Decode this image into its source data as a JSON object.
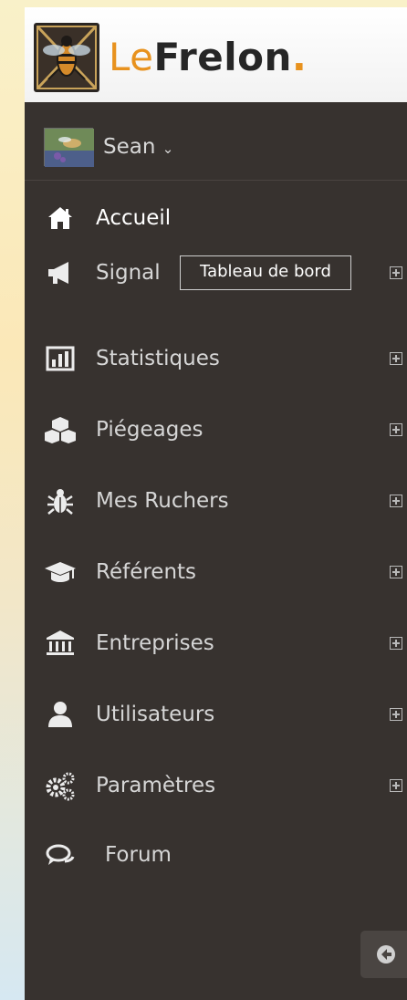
{
  "logo": {
    "part1": "Le",
    "part2": "Frelon",
    "part3": "."
  },
  "user": {
    "name": "Sean",
    "caret": "⌄"
  },
  "nav": {
    "items": [
      {
        "label": "Accueil",
        "icon": "home-icon",
        "active": true
      },
      {
        "label": "Signal",
        "icon": "megaphone-icon"
      },
      {
        "label": "Statistiques",
        "icon": "bar-chart-icon"
      },
      {
        "label": "Piégeages",
        "icon": "cubes-icon"
      },
      {
        "label": "Mes Ruchers",
        "icon": "bug-icon"
      },
      {
        "label": "Référents",
        "icon": "graduation-cap-icon"
      },
      {
        "label": "Entreprises",
        "icon": "bank-icon"
      },
      {
        "label": "Utilisateurs",
        "icon": "user-icon"
      },
      {
        "label": "Paramètres",
        "icon": "gears-icon"
      },
      {
        "label": "Forum",
        "icon": "comments-icon"
      }
    ]
  },
  "tooltip": {
    "text": "Tableau de bord"
  },
  "colors": {
    "sidebar_bg": "#37322f",
    "accent": "#e8921e",
    "text": "#d6d6d6"
  }
}
